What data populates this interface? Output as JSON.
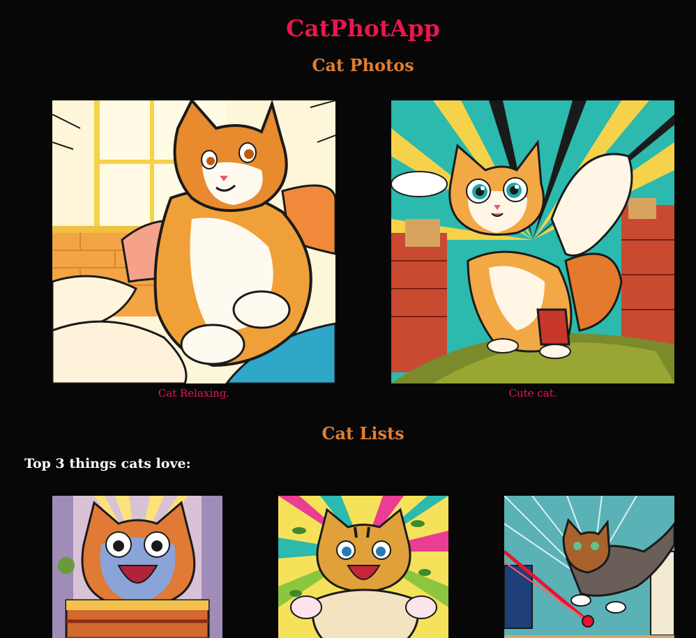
{
  "app": {
    "title": "CatPhotApp"
  },
  "photos_section": {
    "heading": "Cat Photos",
    "figures": [
      {
        "caption": "Cat Relaxing.",
        "image": "relaxing-cat-illustration"
      },
      {
        "caption": "Cute cat.",
        "image": "cute-cat-illustration"
      }
    ]
  },
  "lists_section": {
    "heading": "Cat Lists",
    "intro": "Top 3 things cats love:",
    "images": [
      {
        "image": "cat-lasagna-illustration"
      },
      {
        "image": "cat-catnip-illustration"
      },
      {
        "image": "cat-laser-illustration"
      }
    ]
  },
  "colors": {
    "background": "#070707",
    "title": "#e8174e",
    "headings": "#e07f32",
    "captions": "#e8174e",
    "body_text": "#ffffff"
  }
}
